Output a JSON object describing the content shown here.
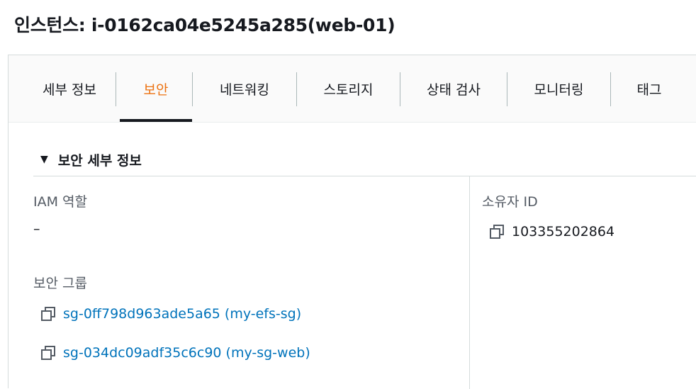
{
  "header": {
    "title": "인스턴스: i-0162ca04e5245a285(web-01)"
  },
  "tabs": [
    {
      "label": "세부 정보"
    },
    {
      "label": "보안"
    },
    {
      "label": "네트워킹"
    },
    {
      "label": "스토리지"
    },
    {
      "label": "상태 검사"
    },
    {
      "label": "모니터링"
    },
    {
      "label": "태그"
    }
  ],
  "active_tab": "보안",
  "section": {
    "title": "보안 세부 정보",
    "iam_role": {
      "label": "IAM 역할",
      "value": "–"
    },
    "owner_id": {
      "label": "소유자 ID",
      "value": "103355202864"
    },
    "security_groups": {
      "label": "보안 그룹",
      "items": [
        "sg-0ff798d963ade5a65 (my-efs-sg)",
        "sg-034dc09adf35c6c90 (my-sg-web)"
      ]
    }
  },
  "colors": {
    "accent": "#ec7211",
    "link": "#0073bb",
    "text": "#16191f",
    "label": "#545b64"
  }
}
